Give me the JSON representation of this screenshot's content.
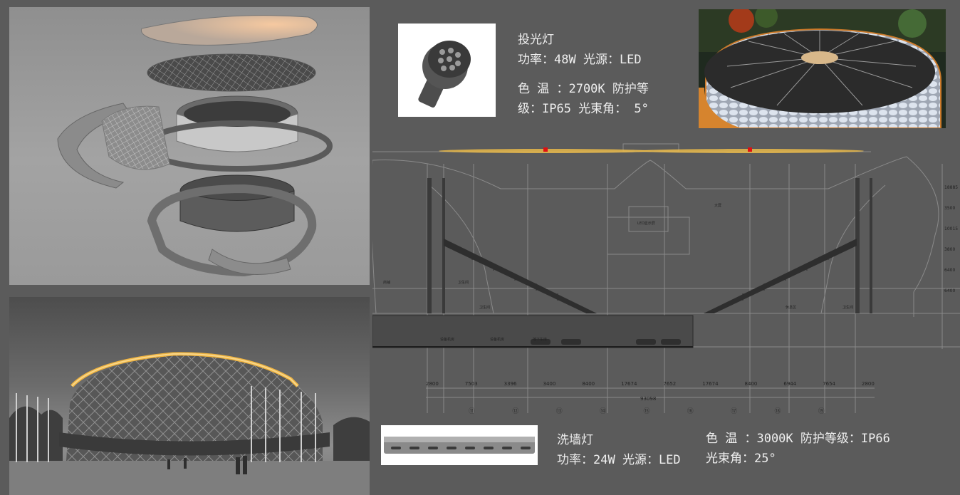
{
  "spotlight": {
    "name": "投光灯",
    "line1": "功率：48W 光源：LED",
    "line2": "色 温 ：2700K  防护等",
    "line3": "级：IP65 光束角： 5°"
  },
  "wallwasher": {
    "name": "洗墙灯",
    "line1": "功率：24W 光源：LED",
    "line2": "色 温 ：3000K  防护等级：IP66",
    "line3": "光束角：25°"
  },
  "section": {
    "dimensions": [
      "2800",
      "7503",
      "3396",
      "3400",
      "8400",
      "17674",
      "7652",
      "17674",
      "8400",
      "6944",
      "7654",
      "2800"
    ],
    "total": "93098",
    "grid_labels": [
      "⑪",
      "⑫",
      "⑬",
      "⑭",
      "⑮",
      "⑯",
      "⑰",
      "⑱",
      "⑲"
    ],
    "vertical_dims": [
      "18885",
      "3500",
      "10015",
      "3800",
      "6400",
      "6400"
    ],
    "small_labels": [
      "大屏",
      "LED显示屏",
      "商铺",
      "卫生间",
      "卫生间",
      "卫生间",
      "休息区",
      "设备机房",
      "地下车库",
      "设备机房"
    ]
  },
  "colors": {
    "background": "#5b5b5b",
    "drawing": "#8a8a8a",
    "glow": "#e8b84a",
    "marker": "#e01010"
  }
}
